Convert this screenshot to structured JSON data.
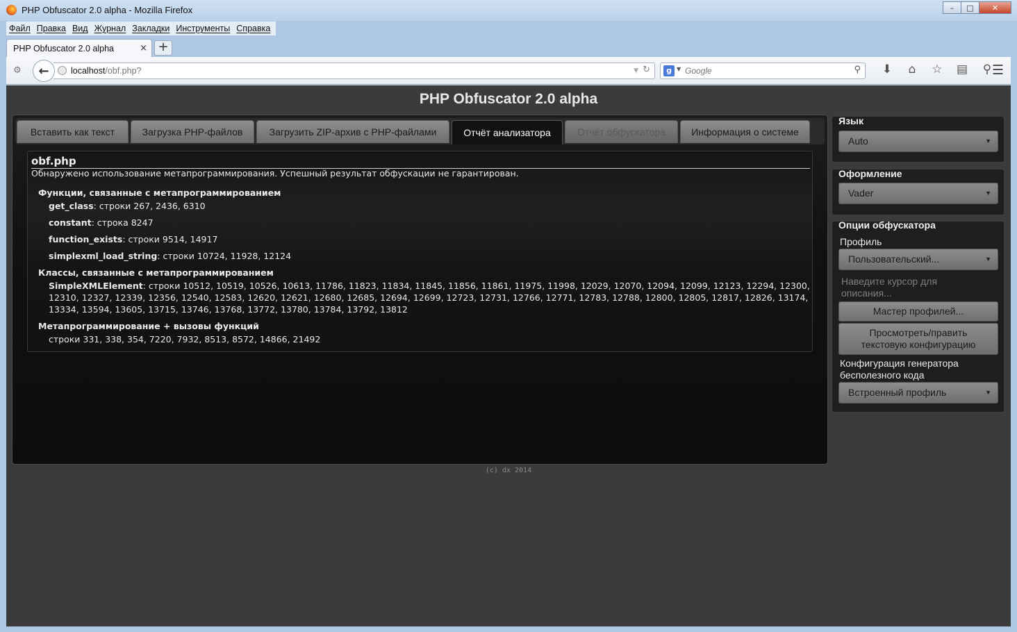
{
  "window": {
    "title": "PHP Obfuscator 2.0 alpha - Mozilla Firefox",
    "min": "–",
    "max": "□",
    "close": "✕"
  },
  "menu": [
    "Файл",
    "Правка",
    "Вид",
    "Журнал",
    "Закладки",
    "Инструменты",
    "Справка"
  ],
  "browser": {
    "tab_label": "PHP Obfuscator 2.0 alpha",
    "tab_close": "×",
    "new_tab": "+",
    "url_host": "localhost",
    "url_path": "/obf.php?",
    "search_placeholder": "Google",
    "search_engine": "g"
  },
  "app": {
    "title": "PHP Obfuscator 2.0 alpha",
    "tabs": [
      {
        "label": "Вставить как текст",
        "state": "normal"
      },
      {
        "label": "Загрузка PHP-файлов",
        "state": "normal"
      },
      {
        "label": "Загрузить ZIP-архив с PHP-файлами",
        "state": "normal"
      },
      {
        "label": "Отчёт анализатора",
        "state": "active"
      },
      {
        "label": "Отчёт обфускатора",
        "state": "disabled"
      },
      {
        "label": "Информация о системе",
        "state": "normal"
      }
    ],
    "footer": "(c) dx 2014"
  },
  "report": {
    "filename": "obf.php",
    "warning": "Обнаружено использование метапрограммирования. Успешный результат обфускации не гарантирован.",
    "functions_heading": "Функции, связанные с метапрограммированием",
    "functions": [
      {
        "name": "get_class",
        "lines": ": строки 267, 2436, 6310"
      },
      {
        "name": "constant",
        "lines": ": строка 8247"
      },
      {
        "name": "function_exists",
        "lines": ": строки 9514, 14917"
      },
      {
        "name": "simplexml_load_string",
        "lines": ": строки 10724, 11928, 12124"
      }
    ],
    "classes_heading": "Классы, связанные с метапрограммированием",
    "class_name": "SimpleXMLElement",
    "class_lines": ": строки 10512, 10519, 10526, 10613, 11786, 11823, 11834, 11845, 11856, 11861, 11975, 11998, 12029, 12070, 12094, 12099, 12123, 12294, 12300, 12310, 12327, 12339, 12356, 12540, 12583, 12620, 12621, 12680, 12685, 12694, 12699, 12723, 12731, 12766, 12771, 12783, 12788, 12800, 12805, 12817, 12826, 13174, 13334, 13594, 13605, 13715, 13746, 13768, 13772, 13780, 13784, 13792, 13812",
    "calls_heading": "Метапрограммирование + вызовы функций",
    "calls_lines": "строки 331, 338, 354, 7220, 7932, 8513, 8572, 14866, 21492"
  },
  "sidebar": {
    "language_title": "Язык",
    "language_value": "Auto",
    "theme_title": "Оформление",
    "theme_value": "Vader",
    "options_title": "Опции обфускатора",
    "profile_label": "Профиль",
    "profile_value": "Пользовательский...",
    "hint_line1": "Наведите курсор для",
    "hint_line2": "описания...",
    "wizard_button": "Мастер профилей...",
    "edit_button_line1": "Просмотреть/править",
    "edit_button_line2": "текстовую конфигурацию",
    "junk_label_line1": "Конфигурация генератора",
    "junk_label_line2": "бесполезного кода",
    "junk_value": "Встроенный профиль"
  },
  "icons": {
    "download": "⬇",
    "home": "⌂",
    "bookmark": "☆",
    "reader": "▤",
    "search": "⚲",
    "menu": "☰",
    "back": "←",
    "reload": "↻",
    "dropdown": "▼"
  }
}
